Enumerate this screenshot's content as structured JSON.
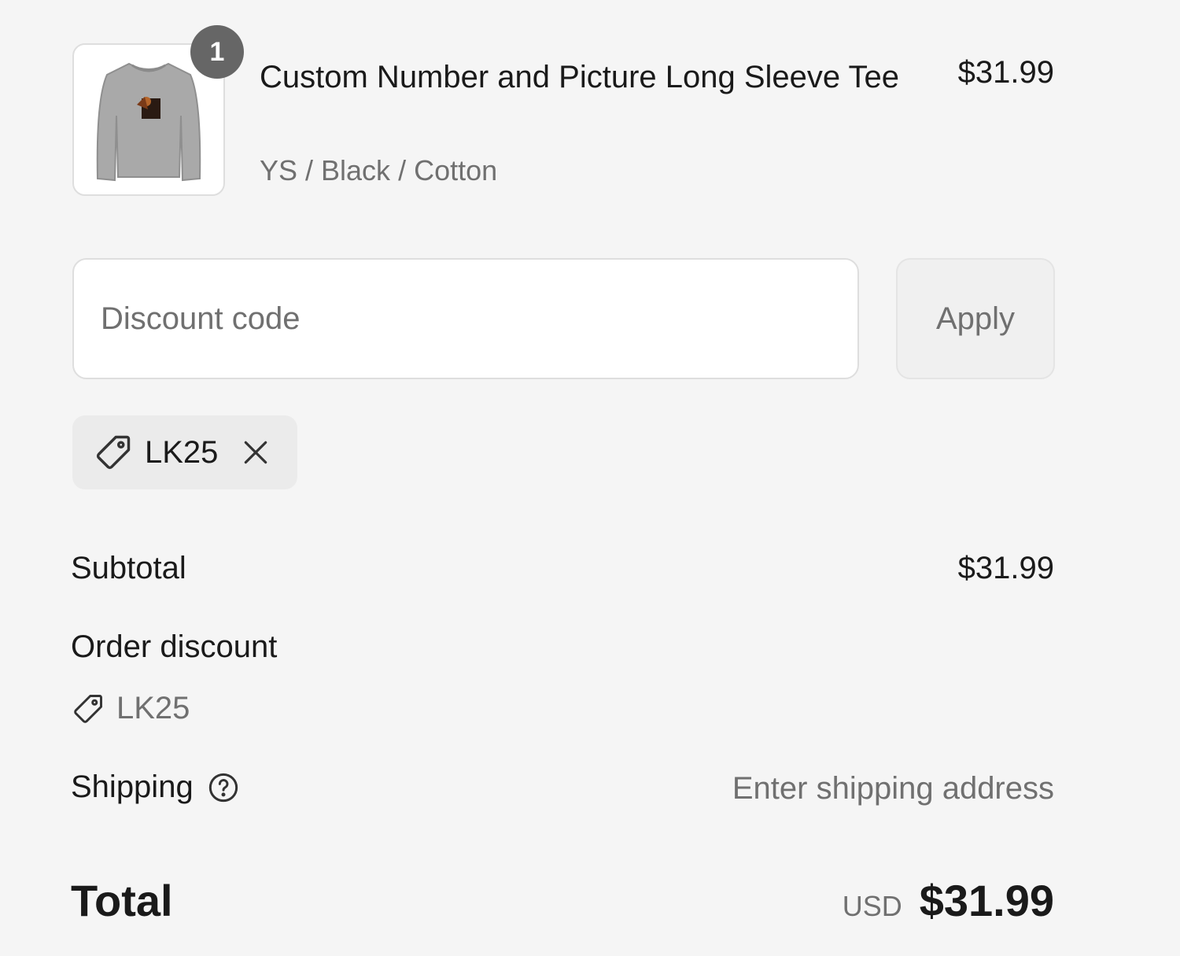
{
  "cart_item": {
    "quantity": "1",
    "name": "Custom Number and Picture Long Sleeve Tee",
    "variant": "YS / Black / Cotton",
    "price": "$31.99",
    "image_icon": "long-sleeve-tee-thumbnail"
  },
  "discount": {
    "placeholder": "Discount code",
    "apply_label": "Apply",
    "applied_code": "LK25"
  },
  "summary": {
    "subtotal_label": "Subtotal",
    "subtotal_value": "$31.99",
    "order_discount_label": "Order discount",
    "order_discount_code": "LK25",
    "shipping_label": "Shipping",
    "shipping_value": "Enter shipping address"
  },
  "total": {
    "label": "Total",
    "currency": "USD",
    "amount": "$31.99"
  },
  "colors": {
    "background": "#f5f5f5",
    "badge": "#666666",
    "muted_text": "#707070",
    "text": "#1a1a1a"
  }
}
